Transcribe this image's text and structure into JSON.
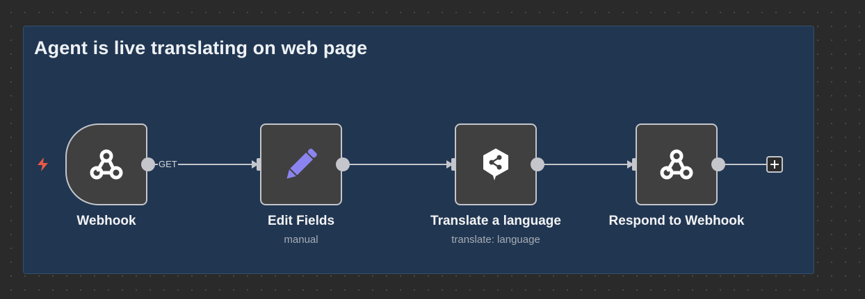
{
  "sticky": {
    "title": "Agent is live translating on web page"
  },
  "nodes": [
    {
      "name": "Webhook",
      "subtitle": "",
      "icon": "webhook-icon"
    },
    {
      "name": "Edit Fields",
      "subtitle": "manual",
      "icon": "pencil-icon"
    },
    {
      "name": "Translate a language",
      "subtitle": "translate: language",
      "icon": "deepl-icon"
    },
    {
      "name": "Respond to Webhook",
      "subtitle": "",
      "icon": "webhook-icon"
    }
  ],
  "connections": [
    {
      "label": "GET"
    }
  ],
  "colors": {
    "canvas": "#2a2a2a",
    "sticky": "#213651",
    "node": "#404040",
    "node_border": "#c4c6cc",
    "trigger_bolt": "#ea5a47",
    "pencil": "#8b84f0"
  }
}
